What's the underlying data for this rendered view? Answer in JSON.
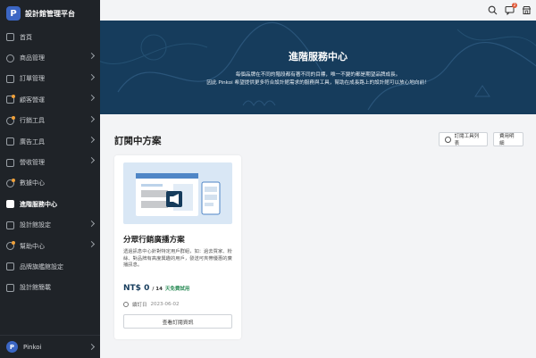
{
  "brand": {
    "logo": "P",
    "title": "設計館管理平台"
  },
  "sidebar": {
    "items": [
      {
        "label": "首頁",
        "icon": "home-icon",
        "dot": false,
        "chevron": false,
        "active": false
      },
      {
        "label": "商品管理",
        "icon": "product-icon",
        "dot": false,
        "chevron": true,
        "active": false
      },
      {
        "label": "訂單管理",
        "icon": "order-icon",
        "dot": false,
        "chevron": true,
        "active": false
      },
      {
        "label": "顧客營運",
        "icon": "customer-icon",
        "dot": true,
        "chevron": true,
        "active": false
      },
      {
        "label": "行銷工具",
        "icon": "marketing-icon",
        "dot": true,
        "chevron": true,
        "active": false
      },
      {
        "label": "廣告工具",
        "icon": "ads-icon",
        "dot": false,
        "chevron": true,
        "active": false
      },
      {
        "label": "營收管理",
        "icon": "revenue-icon",
        "dot": false,
        "chevron": true,
        "active": false
      },
      {
        "label": "數據中心",
        "icon": "data-icon",
        "dot": true,
        "chevron": false,
        "active": false
      },
      {
        "label": "進階服務中心",
        "icon": "service-icon",
        "dot": false,
        "chevron": false,
        "active": true
      },
      {
        "label": "設計館設定",
        "icon": "settings-icon",
        "dot": false,
        "chevron": true,
        "active": false
      },
      {
        "label": "幫助中心",
        "icon": "help-icon",
        "dot": true,
        "chevron": true,
        "active": false
      },
      {
        "label": "品牌旗艦館設定",
        "icon": "flagship-icon",
        "dot": false,
        "chevron": false,
        "active": false
      },
      {
        "label": "設計館簡載",
        "icon": "profile-icon",
        "dot": false,
        "chevron": false,
        "active": false
      }
    ],
    "user": {
      "avatar": "P",
      "name": "Pinkoi"
    }
  },
  "topbar": {
    "notification_count": "2"
  },
  "hero": {
    "title": "進階服務中心",
    "line1": "每個品牌在不同的階段都有著不同的目標，唯一不變的都是期望品牌成長。",
    "line2": "因此 Pinkoi 希望提供更多符合設計館需求的服務與工具，幫助在成長路上的設計館可以放心地向前！"
  },
  "main": {
    "section_title": "訂閱中方案",
    "tools_button": "訂閱工具列表",
    "billing_button": "費用明細",
    "card": {
      "title": "分眾行銷廣播方案",
      "description": "透過訊息中心針對特定用戶群組，如：過去買家、粉絲、對品牌有高度興趣的用戶，發送可夾帶優惠的廣播訊息。",
      "price": "NT$ 0",
      "period": "/ 14",
      "trial": "天免費試用",
      "renew_label": "續訂日",
      "renew_date": "2023-06-02",
      "button": "查看訂閱資訊"
    }
  },
  "colors": {
    "hero_bg": "#163c5c",
    "sidebar_bg": "#1f2328",
    "dot": "#f0a13a",
    "trial": "#2f8e5a"
  }
}
